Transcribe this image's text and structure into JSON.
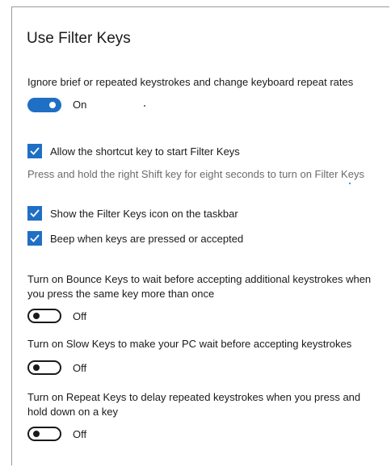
{
  "header": {
    "title": "Use Filter Keys"
  },
  "filter_keys": {
    "description": "Ignore brief or repeated keystrokes and change keyboard repeat rates",
    "toggle_state": "On"
  },
  "options": {
    "shortcut": {
      "label": "Allow the shortcut key to start Filter Keys",
      "checked": true,
      "hint": "Press and hold the right Shift key for eight seconds to turn on Filter Keys"
    },
    "show_icon": {
      "label": "Show the Filter Keys icon on the taskbar",
      "checked": true
    },
    "beep": {
      "label": "Beep when keys are pressed or accepted",
      "checked": true
    }
  },
  "bounce_keys": {
    "description": "Turn on Bounce Keys to wait before accepting additional keystrokes when you press the same key more than once",
    "toggle_state": "Off"
  },
  "slow_keys": {
    "description": "Turn on Slow Keys to make your PC wait before accepting keystrokes",
    "toggle_state": "Off"
  },
  "repeat_keys": {
    "description": "Turn on Repeat Keys to delay repeated keystrokes when you press and hold down on a key",
    "toggle_state": "Off"
  },
  "colors": {
    "accent": "#1f6fc4",
    "text": "#1a1a1a",
    "muted": "#6b6b6b"
  }
}
